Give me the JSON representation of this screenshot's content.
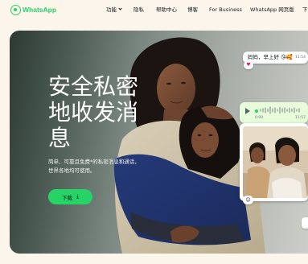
{
  "brand": {
    "name": "WhatsApp",
    "color": "#25d366",
    "icon": "whatsapp-logo-icon"
  },
  "nav": {
    "items": [
      {
        "label": "功能",
        "has_dropdown": true
      },
      {
        "label": "隐私"
      },
      {
        "label": "帮助中心"
      },
      {
        "label": "博客"
      },
      {
        "label": "For Business"
      },
      {
        "label": "WhatsApp 网页版"
      },
      {
        "label": "下"
      }
    ]
  },
  "hero": {
    "title": "安全私密地收发消息",
    "subtitle": "简单、可靠且免费*的私密消息和通话，世界各地均可使用。",
    "download_label": "下载",
    "download_icon": "download-icon",
    "accent": "#25d366"
  },
  "chat": {
    "message_text": "妈妈，早上好 😘🥰",
    "message_time": "11:54",
    "heart_reaction": "♥",
    "voice_duration": "0:00",
    "voice_time": "11:57",
    "photo_reaction": "😊"
  }
}
